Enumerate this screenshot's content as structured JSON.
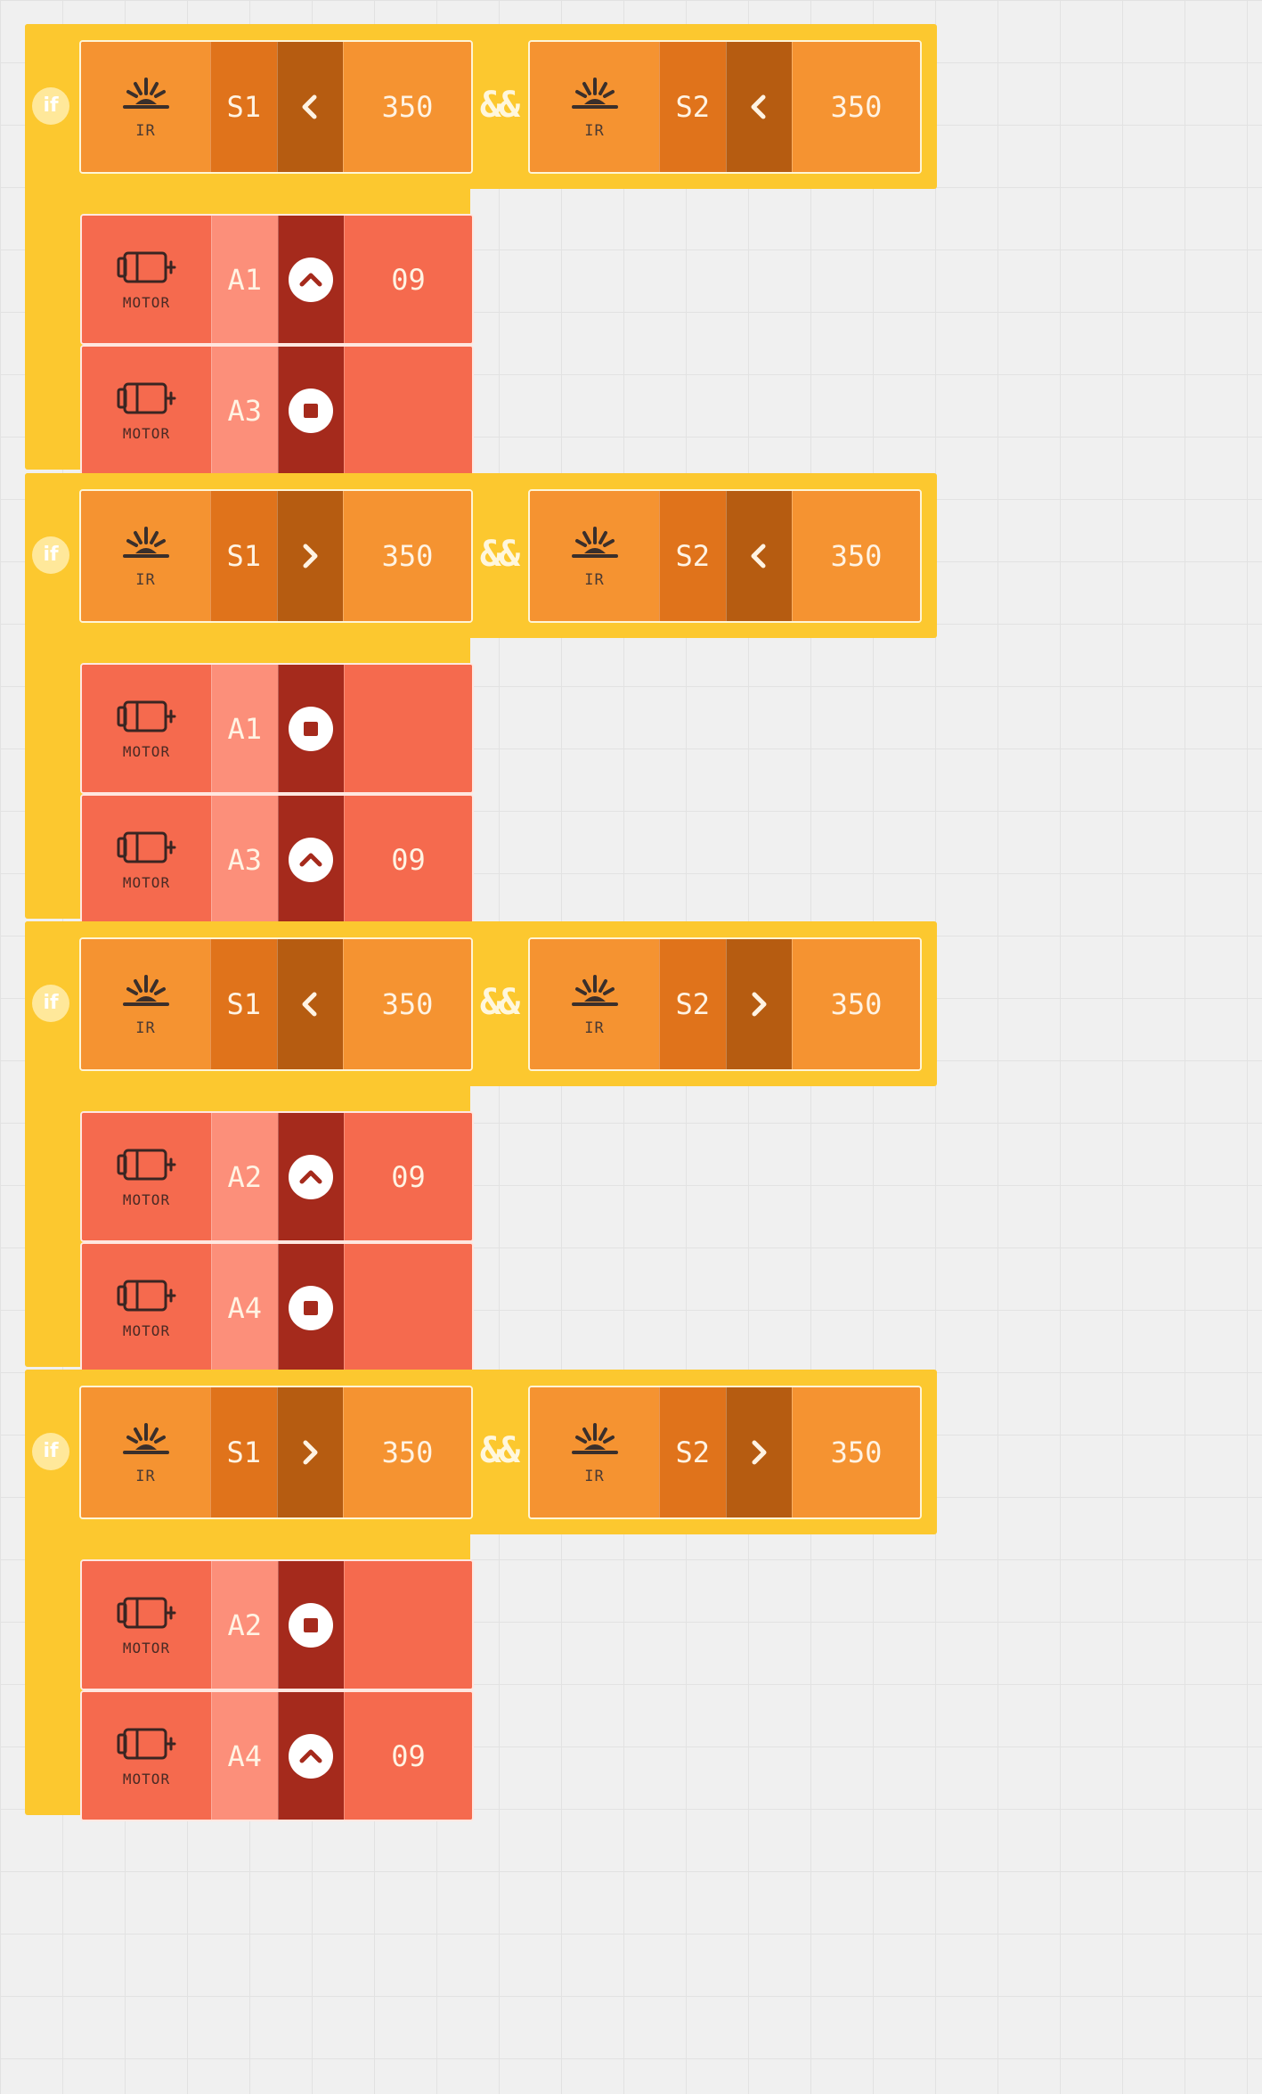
{
  "blocks": [
    {
      "if_label": "if",
      "op": "&&",
      "conditions": [
        {
          "sensor": "IR",
          "port": "S1",
          "cmp": "lt",
          "value": "350"
        },
        {
          "sensor": "IR",
          "port": "S2",
          "cmp": "lt",
          "value": "350"
        }
      ],
      "motors": [
        {
          "label": "MOTOR",
          "port": "A1",
          "action": "up",
          "value": "09"
        },
        {
          "label": "MOTOR",
          "port": "A3",
          "action": "stop",
          "value": ""
        }
      ]
    },
    {
      "if_label": "if",
      "op": "&&",
      "conditions": [
        {
          "sensor": "IR",
          "port": "S1",
          "cmp": "gt",
          "value": "350"
        },
        {
          "sensor": "IR",
          "port": "S2",
          "cmp": "lt",
          "value": "350"
        }
      ],
      "motors": [
        {
          "label": "MOTOR",
          "port": "A1",
          "action": "stop",
          "value": ""
        },
        {
          "label": "MOTOR",
          "port": "A3",
          "action": "up",
          "value": "09"
        }
      ]
    },
    {
      "if_label": "if",
      "op": "&&",
      "conditions": [
        {
          "sensor": "IR",
          "port": "S1",
          "cmp": "lt",
          "value": "350"
        },
        {
          "sensor": "IR",
          "port": "S2",
          "cmp": "gt",
          "value": "350"
        }
      ],
      "motors": [
        {
          "label": "MOTOR",
          "port": "A2",
          "action": "up",
          "value": "09"
        },
        {
          "label": "MOTOR",
          "port": "A4",
          "action": "stop",
          "value": ""
        }
      ]
    },
    {
      "if_label": "if",
      "op": "&&",
      "conditions": [
        {
          "sensor": "IR",
          "port": "S1",
          "cmp": "gt",
          "value": "350"
        },
        {
          "sensor": "IR",
          "port": "S2",
          "cmp": "gt",
          "value": "350"
        }
      ],
      "motors": [
        {
          "label": "MOTOR",
          "port": "A2",
          "action": "stop",
          "value": ""
        },
        {
          "label": "MOTOR",
          "port": "A4",
          "action": "up",
          "value": "09"
        }
      ]
    }
  ],
  "icons": {
    "condition_sensor": "ir-sensor-icon",
    "motor": "motor-icon",
    "cmp_lt": "chevron-left-icon",
    "cmp_gt": "chevron-right-icon",
    "action_up": "chevron-up-icon",
    "action_stop": "stop-icon"
  },
  "colors": {
    "if_block": "#fcc82f",
    "sensor_block": "#f59331",
    "port_cell": "#e0731b",
    "compare_cell": "#b65c11",
    "motor_block": "#f56a4e",
    "motor_port": "#fc8f7a",
    "motor_action": "#a52a1c"
  }
}
